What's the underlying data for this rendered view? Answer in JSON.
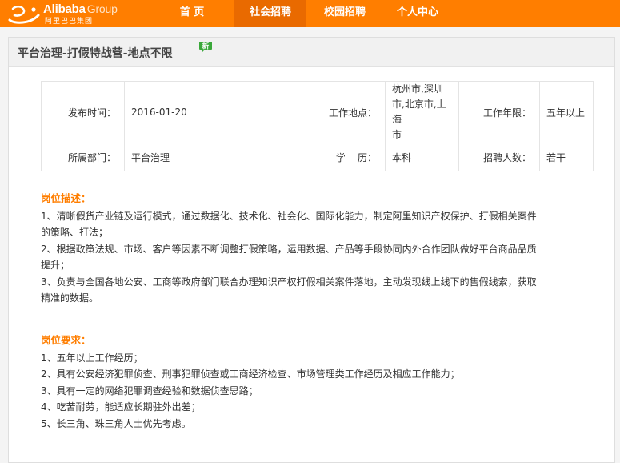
{
  "header": {
    "logo": {
      "word": "Alibaba",
      "group": "Group",
      "cn": "阿里巴巴集团"
    },
    "nav": [
      {
        "label": "首  页",
        "active": false
      },
      {
        "label": "社会招聘",
        "active": true
      },
      {
        "label": "校园招聘",
        "active": false
      },
      {
        "label": "个人中心",
        "active": false
      }
    ],
    "colors": {
      "brand": "#ff7e00",
      "active_tab": "#e96a00"
    }
  },
  "job": {
    "title": "平台治理-打假特战营-地点不限",
    "new_badge_icon": "new-badge-icon",
    "new_badge_text": "新",
    "info": {
      "publish_label": "发布时间：",
      "publish_value": "2016-01-20",
      "location_label": "工作地点：",
      "location_lines": [
        "杭州市,深圳",
        "市,北京市,上海",
        "市"
      ],
      "years_label": "工作年限：",
      "years_value": "五年以上",
      "dept_label": "所属部门：",
      "dept_value": "平台治理",
      "edu_label": "学    历：",
      "edu_value": "本科",
      "headcount_label": "招聘人数：",
      "headcount_value": "若干"
    },
    "description": {
      "heading": "岗位描述：",
      "lines": [
        "1、清晰假货产业链及运行模式，通过数据化、技术化、社会化、国际化能力，制定阿里知识产权保护、打假相关案件",
        "的策略、打法；",
        "2、根据政策法规、市场、客户等因素不断调整打假策略，运用数据、产品等手段协同内外合作团队做好平台商品品质",
        "提升；",
        "3、负责与全国各地公安、工商等政府部门联合办理知识产权打假相关案件落地，主动发现线上线下的售假线索，获取",
        "精准的数据。"
      ]
    },
    "requirements": {
      "heading": "岗位要求：",
      "lines": [
        "1、五年以上工作经历；",
        "2、具有公安经济犯罪侦查、刑事犯罪侦查或工商经济检查、市场管理类工作经历及相应工作能力；",
        "3、具有一定的网络犯罪调查经验和数据侦查思路；",
        "4、吃苦耐劳，能适应长期驻外出差；",
        "5、长三角、珠三角人士优先考虑。"
      ]
    }
  }
}
